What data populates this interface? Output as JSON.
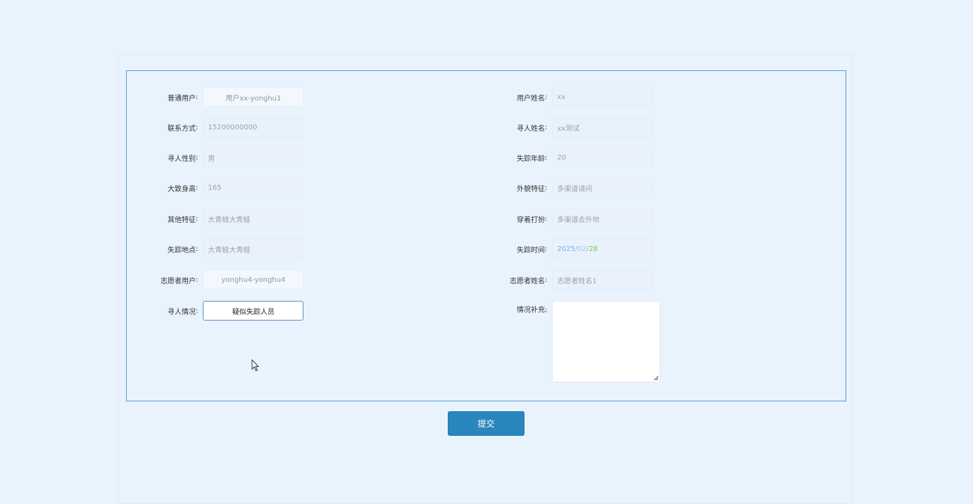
{
  "form": {
    "left": [
      {
        "label": "普通用户",
        "value": "用户xx-yonghu1",
        "kind": "select"
      },
      {
        "label": "联系方式",
        "value": "15200000000",
        "kind": "input"
      },
      {
        "label": "寻人性别",
        "value": "男",
        "kind": "input"
      },
      {
        "label": "大致身高",
        "value": "165",
        "kind": "input"
      },
      {
        "label": "其他特征",
        "value": "大青蛙大青蛙",
        "kind": "input"
      },
      {
        "label": "失踪地点",
        "value": "大青蛙大青蛙",
        "kind": "input"
      },
      {
        "label": "志愿者用户",
        "value": "yonghu4-yonghu4",
        "kind": "select"
      },
      {
        "label": "寻人情况",
        "value": "疑似失踪人员",
        "kind": "select-active"
      }
    ],
    "right": [
      {
        "label": "用户姓名",
        "value": "xx"
      },
      {
        "label": "寻人姓名",
        "value": "xx测试"
      },
      {
        "label": "失踪年龄",
        "value": "20"
      },
      {
        "label": "外貌特征",
        "value": "多渠道请问"
      },
      {
        "label": "穿着打扮",
        "value": "多渠道去外地"
      },
      {
        "label": "失踪时间",
        "value_year": "2025",
        "value_month": "02",
        "value_day": "28",
        "sep": "/"
      },
      {
        "label": "志愿者姓名",
        "value": "志愿者姓名1"
      },
      {
        "label": "情况补充",
        "value": ""
      }
    ],
    "colon": ":"
  },
  "submit_label": "提交",
  "colors": {
    "background": "#e8f3fe",
    "border": "#5c9bd0",
    "button": "#2a86bd"
  }
}
